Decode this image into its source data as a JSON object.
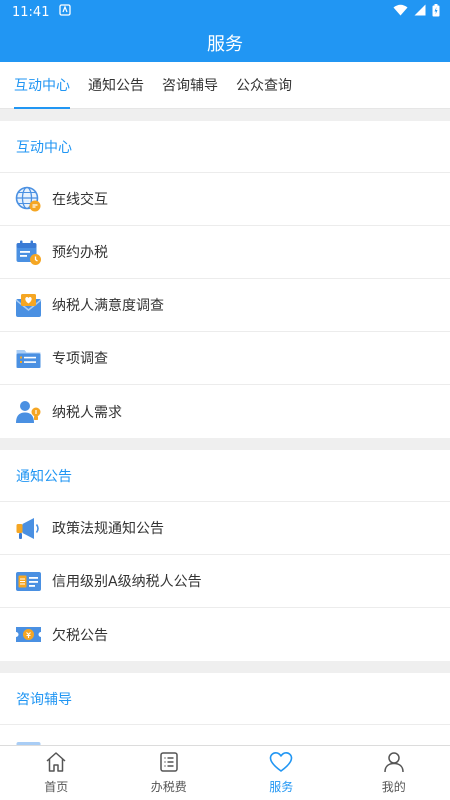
{
  "status": {
    "time": "11:41"
  },
  "app": {
    "title": "服务"
  },
  "tabs": [
    {
      "label": "互动中心",
      "active": true
    },
    {
      "label": "通知公告",
      "active": false
    },
    {
      "label": "咨询辅导",
      "active": false
    },
    {
      "label": "公众查询",
      "active": false
    }
  ],
  "sections": [
    {
      "title": "互动中心",
      "items": [
        {
          "label": "在线交互",
          "icon": "globe-icon"
        },
        {
          "label": "预约办税",
          "icon": "calendar-icon"
        },
        {
          "label": "纳税人满意度调查",
          "icon": "envelope-heart-icon"
        },
        {
          "label": "专项调查",
          "icon": "folder-list-icon"
        },
        {
          "label": "纳税人需求",
          "icon": "user-bulb-icon"
        }
      ]
    },
    {
      "title": "通知公告",
      "items": [
        {
          "label": "政策法规通知公告",
          "icon": "megaphone-icon"
        },
        {
          "label": "信用级别A级纳税人公告",
          "icon": "credit-card-icon"
        },
        {
          "label": "欠税公告",
          "icon": "tax-ticket-icon"
        }
      ]
    },
    {
      "title": "咨询辅导",
      "items": []
    }
  ],
  "bottom_nav": [
    {
      "label": "首页",
      "icon": "home-icon",
      "active": false
    },
    {
      "label": "办税费",
      "icon": "list-icon",
      "active": false
    },
    {
      "label": "服务",
      "icon": "heart-icon",
      "active": true
    },
    {
      "label": "我的",
      "icon": "user-icon",
      "active": false
    }
  ],
  "colors": {
    "primary": "#2196f3"
  }
}
